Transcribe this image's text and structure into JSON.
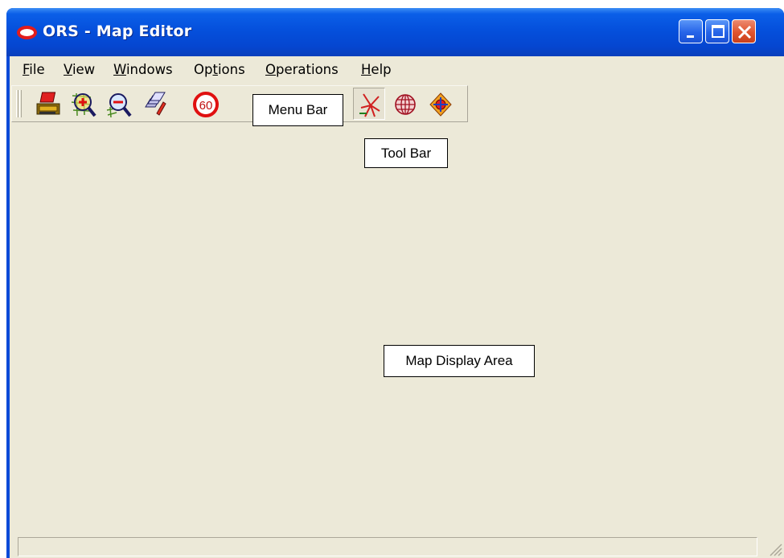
{
  "window": {
    "title": "ORS - Map Editor",
    "icon": "oracle-logo-icon"
  },
  "title_buttons": {
    "minimize": "minimize-icon",
    "maximize": "maximize-icon",
    "close": "close-icon"
  },
  "menu": {
    "items": [
      {
        "label": "File",
        "mnemonic_index": 0
      },
      {
        "label": "View",
        "mnemonic_index": 0
      },
      {
        "label": "Windows",
        "mnemonic_index": 0
      },
      {
        "label": "Options",
        "mnemonic_index": 2
      },
      {
        "label": "Operations",
        "mnemonic_index": 0
      },
      {
        "label": "Help",
        "mnemonic_index": 0
      }
    ]
  },
  "toolbar": {
    "buttons": [
      {
        "icon": "print-icon"
      },
      {
        "icon": "zoom-in-icon"
      },
      {
        "icon": "zoom-out-icon"
      },
      {
        "icon": "layers-icon"
      },
      {
        "icon": "speed-limit-60-icon",
        "text": "60"
      },
      {
        "icon": "hidden-behind-label-icon"
      },
      {
        "icon": "hidden-behind-label-icon"
      },
      {
        "icon": "network-links-icon",
        "pressed": true
      },
      {
        "icon": "globe-icon"
      },
      {
        "icon": "center-map-icon"
      }
    ]
  },
  "callouts": {
    "menu_bar": "Menu Bar",
    "tool_bar": "Tool Bar",
    "map_display_area": "Map Display Area"
  },
  "colors": {
    "titlebar": "#0550dc",
    "client_background": "#ece9d8",
    "close_button": "#e0542e",
    "oracle_red": "#e21c1c"
  }
}
